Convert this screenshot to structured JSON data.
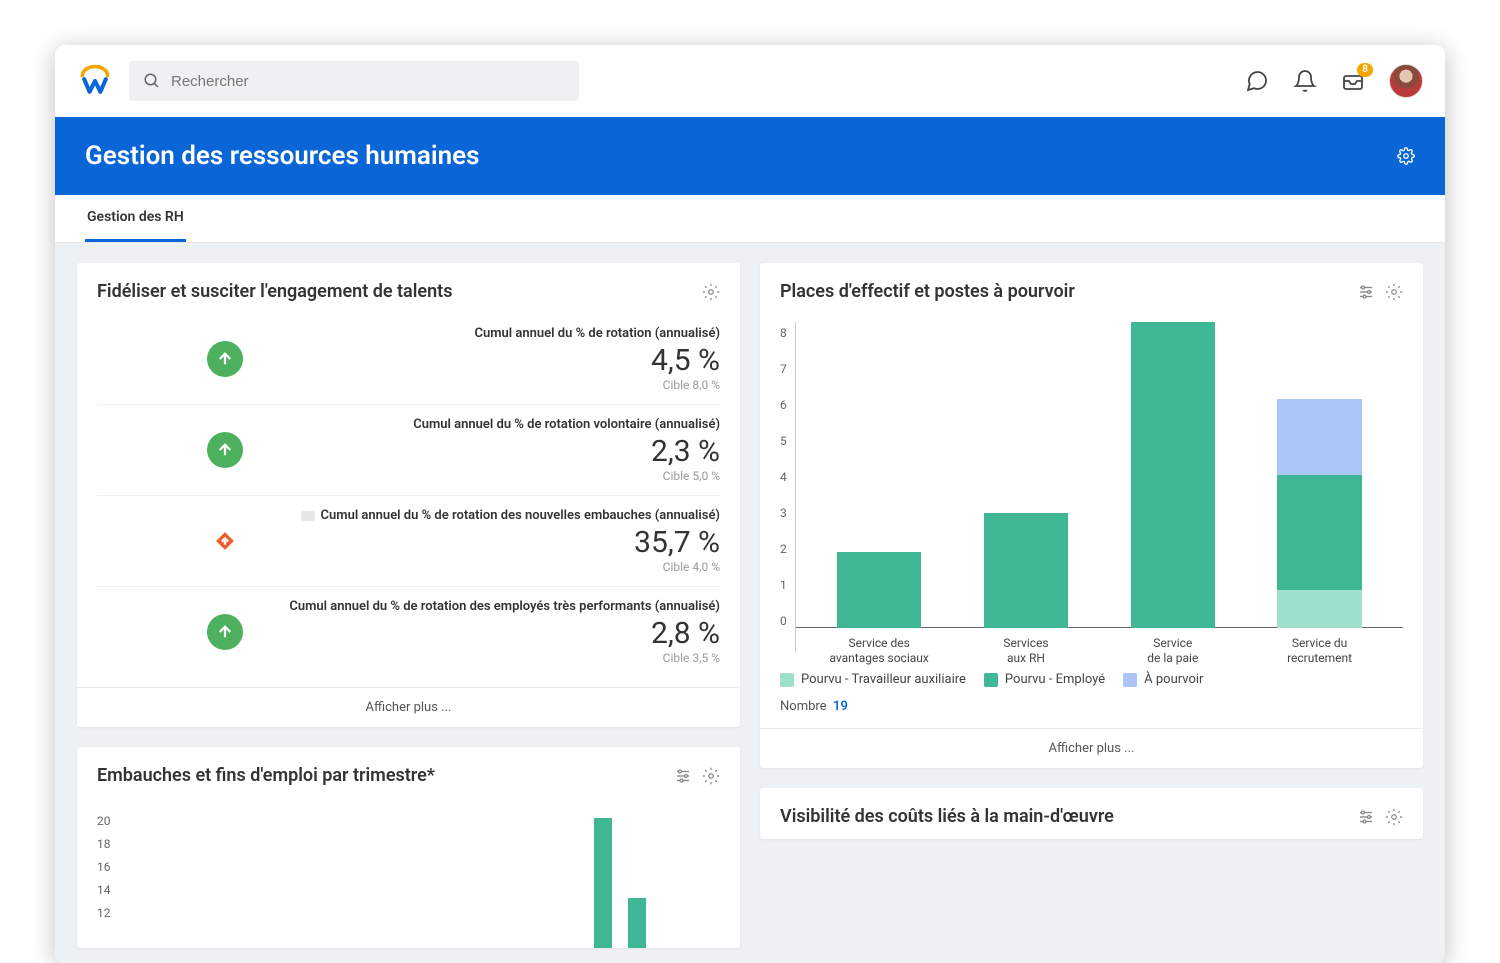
{
  "search": {
    "placeholder": "Rechercher"
  },
  "inbox_badge": "8",
  "header": {
    "title": "Gestion des ressources humaines"
  },
  "tabs": {
    "active": "Gestion des RH"
  },
  "card1": {
    "title": "Fidéliser et susciter l'engagement de talents",
    "showmore": "Afficher plus ...",
    "kpis": [
      {
        "label": "Cumul annuel du % de rotation (annualisé)",
        "value": "4,5 %",
        "target": "Cible 8,0 %",
        "icon": "up"
      },
      {
        "label": "Cumul annuel du % de rotation volontaire (annualisé)",
        "value": "2,3 %",
        "target": "Cible 5,0 %",
        "icon": "up"
      },
      {
        "label": "Cumul annuel du % de rotation des nouvelles embauches (annualisé)",
        "value": "35,7 %",
        "target": "Cible 4,0 %",
        "icon": "diamond",
        "flag": true
      },
      {
        "label": "Cumul annuel du % de rotation des employés très performants (annualisé)",
        "value": "2,8 %",
        "target": "Cible 3,5 %",
        "icon": "up"
      }
    ]
  },
  "card2": {
    "title": "Embauches et fins d'emploi par trimestre*",
    "yticks": [
      "20",
      "18",
      "16",
      "14",
      "12"
    ]
  },
  "card3": {
    "title": "Places d'effectif et postes à pourvoir",
    "showmore": "Afficher plus ...",
    "yticks": [
      "0",
      "1",
      "2",
      "3",
      "4",
      "5",
      "6",
      "7",
      "8"
    ],
    "cats": [
      "Service des\navantages sociaux",
      "Services\naux RH",
      "Service\nde la paie",
      "Service du\nrecrutement"
    ],
    "legend": {
      "aux": "Pourvu - Travailleur auxiliaire",
      "emp": "Pourvu - Employé",
      "open": "À pourvoir"
    },
    "count_label": "Nombre",
    "count_val": "19"
  },
  "card4": {
    "title": "Visibilité des coûts liés à la main-d'œuvre"
  },
  "chart_data": [
    {
      "type": "bar",
      "title": "Places d'effectif et postes à pourvoir",
      "categories": [
        "Service des avantages sociaux",
        "Services aux RH",
        "Service de la paie",
        "Service du recrutement"
      ],
      "series": [
        {
          "name": "Pourvu - Travailleur auxiliaire",
          "values": [
            0,
            0,
            0,
            1
          ]
        },
        {
          "name": "Pourvu - Employé",
          "values": [
            2,
            3,
            8,
            3
          ]
        },
        {
          "name": "À pourvoir",
          "values": [
            0,
            0,
            0,
            2
          ]
        }
      ],
      "ylim": [
        0,
        8
      ],
      "stacked": true,
      "total": 19
    },
    {
      "type": "bar",
      "title": "Embauches et fins d'emploi par trimestre*",
      "ylim": [
        12,
        20
      ],
      "visible_values": [
        20,
        13
      ],
      "note": "partially visible"
    }
  ]
}
